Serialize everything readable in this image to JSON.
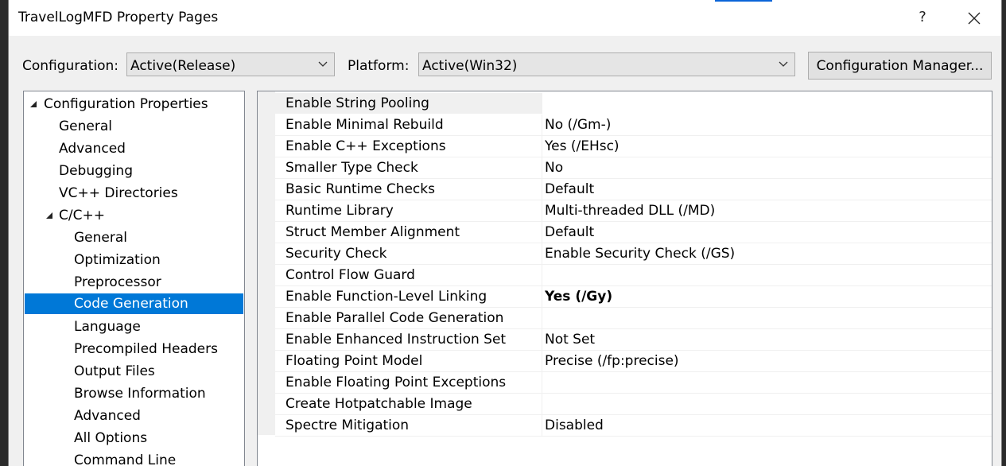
{
  "window": {
    "title": "TravelLogMFD Property Pages",
    "help_label": "?"
  },
  "toolbar": {
    "configuration_label": "Configuration:",
    "configuration_value": "Active(Release)",
    "platform_label": "Platform:",
    "platform_value": "Active(Win32)",
    "config_manager_label": "Configuration Manager..."
  },
  "tree": {
    "items": [
      {
        "label": "Configuration Properties",
        "level": 0,
        "expanded": true
      },
      {
        "label": "General",
        "level": 1
      },
      {
        "label": "Advanced",
        "level": 1
      },
      {
        "label": "Debugging",
        "level": 1
      },
      {
        "label": "VC++ Directories",
        "level": 1
      },
      {
        "label": "C/C++",
        "level": 1,
        "expanded": true
      },
      {
        "label": "General",
        "level": 2
      },
      {
        "label": "Optimization",
        "level": 2
      },
      {
        "label": "Preprocessor",
        "level": 2
      },
      {
        "label": "Code Generation",
        "level": 2,
        "selected": true
      },
      {
        "label": "Language",
        "level": 2
      },
      {
        "label": "Precompiled Headers",
        "level": 2
      },
      {
        "label": "Output Files",
        "level": 2
      },
      {
        "label": "Browse Information",
        "level": 2
      },
      {
        "label": "Advanced",
        "level": 2
      },
      {
        "label": "All Options",
        "level": 2
      },
      {
        "label": "Command Line",
        "level": 2
      }
    ]
  },
  "properties": [
    {
      "name": "Enable String Pooling",
      "value": ""
    },
    {
      "name": "Enable Minimal Rebuild",
      "value": "No (/Gm-)"
    },
    {
      "name": "Enable C++ Exceptions",
      "value": "Yes (/EHsc)"
    },
    {
      "name": "Smaller Type Check",
      "value": "No"
    },
    {
      "name": "Basic Runtime Checks",
      "value": "Default"
    },
    {
      "name": "Runtime Library",
      "value": "Multi-threaded DLL (/MD)"
    },
    {
      "name": "Struct Member Alignment",
      "value": "Default"
    },
    {
      "name": "Security Check",
      "value": "Enable Security Check (/GS)"
    },
    {
      "name": "Control Flow Guard",
      "value": ""
    },
    {
      "name": "Enable Function-Level Linking",
      "value": "Yes (/Gy)",
      "bold": true
    },
    {
      "name": "Enable Parallel Code Generation",
      "value": ""
    },
    {
      "name": "Enable Enhanced Instruction Set",
      "value": "Not Set"
    },
    {
      "name": "Floating Point Model",
      "value": "Precise (/fp:precise)"
    },
    {
      "name": "Enable Floating Point Exceptions",
      "value": ""
    },
    {
      "name": "Create Hotpatchable Image",
      "value": ""
    },
    {
      "name": "Spectre Mitigation",
      "value": "Disabled"
    }
  ],
  "colors": {
    "selection": "#0078d7",
    "title_accent": "#0a64d8"
  },
  "icons": {
    "close": "close-icon",
    "dropdown": "chevron-down-icon",
    "expanded": "expanded-triangle-icon"
  }
}
